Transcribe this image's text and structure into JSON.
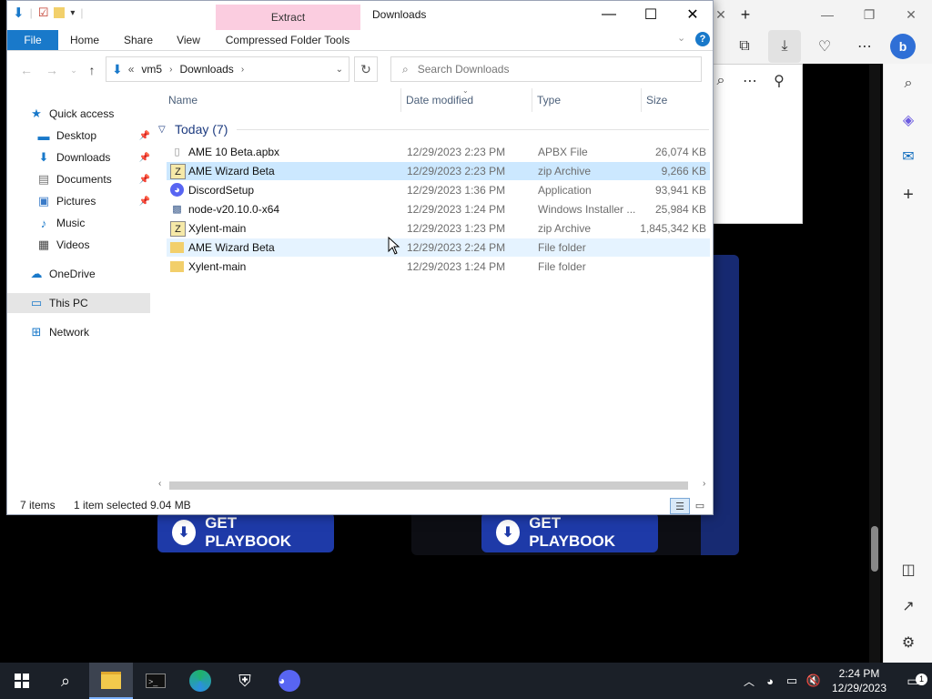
{
  "browser": {
    "sidebar_icons": [
      "search-icon",
      "copilot-icon",
      "outlook-icon",
      "add-icon"
    ],
    "playbook_button_label": "GET PLAYBOOK"
  },
  "explorer": {
    "window_title": "Downloads",
    "context_tab_header": "Extract",
    "ribbon_tabs": [
      "File",
      "Home",
      "Share",
      "View",
      "Compressed Folder Tools"
    ],
    "address": {
      "overflow": "«",
      "crumbs": [
        "vm5",
        "Downloads"
      ]
    },
    "search_placeholder": "Search Downloads",
    "nav": {
      "quick_access": "Quick access",
      "items": [
        "Desktop",
        "Downloads",
        "Documents",
        "Pictures",
        "Music",
        "Videos"
      ],
      "onedrive": "OneDrive",
      "this_pc": "This PC",
      "network": "Network"
    },
    "columns": {
      "name": "Name",
      "date": "Date modified",
      "type": "Type",
      "size": "Size"
    },
    "group_title": "Today (7)",
    "files": [
      {
        "name": "AME 10 Beta.apbx",
        "date": "12/29/2023 2:23 PM",
        "type": "APBX File",
        "size": "26,074 KB",
        "icon": "document-icon"
      },
      {
        "name": "AME Wizard Beta",
        "date": "12/29/2023 2:23 PM",
        "type": "zip Archive",
        "size": "9,266 KB",
        "icon": "zip-icon"
      },
      {
        "name": "DiscordSetup",
        "date": "12/29/2023 1:36 PM",
        "type": "Application",
        "size": "93,941 KB",
        "icon": "discord-icon"
      },
      {
        "name": "node-v20.10.0-x64",
        "date": "12/29/2023 1:24 PM",
        "type": "Windows Installer ...",
        "size": "25,984 KB",
        "icon": "installer-icon"
      },
      {
        "name": "Xylent-main",
        "date": "12/29/2023 1:23 PM",
        "type": "zip Archive",
        "size": "1,845,342 KB",
        "icon": "zip-icon"
      },
      {
        "name": "AME Wizard Beta",
        "date": "12/29/2023 2:24 PM",
        "type": "File folder",
        "size": "",
        "icon": "folder-icon"
      },
      {
        "name": "Xylent-main",
        "date": "12/29/2023 1:24 PM",
        "type": "File folder",
        "size": "",
        "icon": "folder-icon"
      }
    ],
    "status": {
      "items": "7 items",
      "selected": "1 item selected",
      "selected_size": "9.04 MB"
    }
  },
  "taskbar": {
    "clock_time": "2:24 PM",
    "clock_date": "12/29/2023",
    "notification_count": "1"
  },
  "colors": {
    "file_tab": "#1979ca",
    "selection": "#cce8ff",
    "context_tab": "#fbcde0",
    "playbook_button": "#1e3aa8"
  }
}
